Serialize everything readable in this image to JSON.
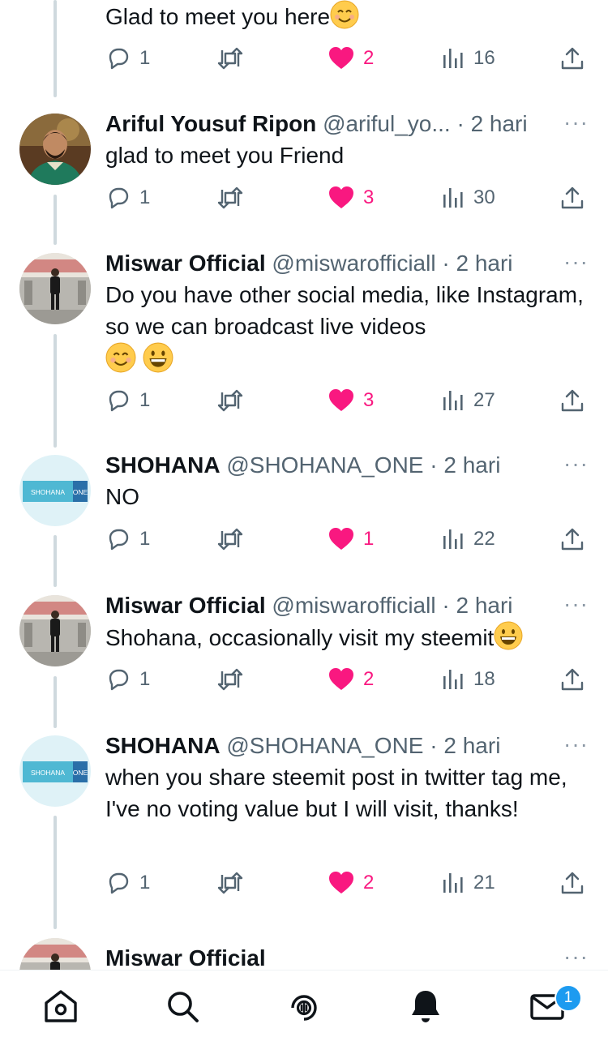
{
  "colors": {
    "accent": "#1d9bf0",
    "like": "#f91880",
    "muted": "#536471",
    "text": "#0f1419"
  },
  "tweets": [
    {
      "name": "",
      "handle": "",
      "time": "",
      "text": "Glad to meet you here",
      "emojis": [
        "smiling-face-emoji"
      ],
      "replies": "1",
      "likes": "2",
      "views": "16",
      "avatar": "none"
    },
    {
      "name": "Ariful Yousuf Ripon",
      "handle": "@ariful_yo...",
      "time": "2 hari",
      "text": "glad to meet you Friend",
      "replies": "1",
      "likes": "3",
      "views": "30",
      "avatar": "portrait"
    },
    {
      "name": "Miswar Official",
      "handle": "@miswarofficiall",
      "time": "2 hari",
      "text": "Do you have other social media, like Instagram, so we can broadcast live videos",
      "emojis": [
        "smiling-face-emoji",
        "grinning-face-emoji"
      ],
      "replies": "1",
      "likes": "3",
      "views": "27",
      "avatar": "stage"
    },
    {
      "name": "SHOHANA",
      "handle": "@SHOHANA_ONE",
      "time": "2 hari",
      "text": "NO",
      "replies": "1",
      "likes": "1",
      "views": "22",
      "avatar": "shohana"
    },
    {
      "name": "Miswar Official",
      "handle": "@miswarofficiall",
      "time": "2 hari",
      "text": "Shohana, occasionally visit my steemit",
      "emojis": [
        "grinning-face-emoji"
      ],
      "replies": "1",
      "likes": "2",
      "views": "18",
      "avatar": "stage"
    },
    {
      "name": "SHOHANA",
      "handle": "@SHOHANA_ONE",
      "time": "2 hari",
      "text": "when you share steemit post in twitter tag me, I've no voting value but I will visit, thanks!",
      "replies": "1",
      "likes": "2",
      "views": "21",
      "avatar": "shohana"
    },
    {
      "name": "Miswar Official",
      "avatar": "stage"
    }
  ],
  "dot": "·",
  "more": "···",
  "avatar_logo": {
    "left": "SHOHANA",
    "right": "ONE"
  },
  "nav": {
    "items": [
      "home-icon",
      "search-icon",
      "spaces-icon",
      "notifications-icon",
      "messages-icon"
    ],
    "messages_badge": "1"
  }
}
